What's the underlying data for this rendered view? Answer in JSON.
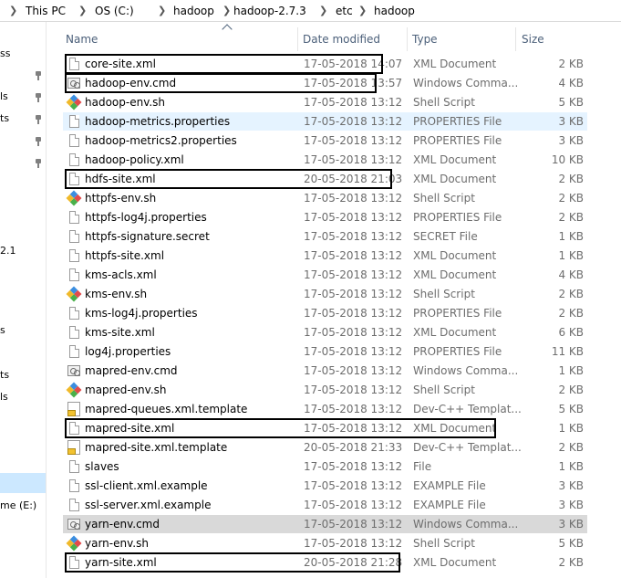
{
  "breadcrumb": [
    "This PC",
    "OS (C:)",
    "hadoop",
    "hadoop-2.7.3",
    "etc",
    "hadoop"
  ],
  "nav_fragments": [
    "ss",
    "ls",
    "ts",
    "2.1",
    "s",
    "ts",
    "ls",
    "me (E:)"
  ],
  "columns": {
    "name": "Name",
    "date": "Date modified",
    "type": "Type",
    "size": "Size"
  },
  "files": [
    {
      "name": "core-site.xml",
      "date": "17-05-2018 14:07",
      "type": "XML Document",
      "size": "2 KB",
      "icon": "file-icon"
    },
    {
      "name": "hadoop-env.cmd",
      "date": "17-05-2018 13:57",
      "type": "Windows Comma...",
      "size": "4 KB",
      "icon": "cmd-icon"
    },
    {
      "name": "hadoop-env.sh",
      "date": "17-05-2018 13:12",
      "type": "Shell Script",
      "size": "5 KB",
      "icon": "shell-icon"
    },
    {
      "name": "hadoop-metrics.properties",
      "date": "17-05-2018 13:12",
      "type": "PROPERTIES File",
      "size": "3 KB",
      "icon": "file-icon"
    },
    {
      "name": "hadoop-metrics2.properties",
      "date": "17-05-2018 13:12",
      "type": "PROPERTIES File",
      "size": "3 KB",
      "icon": "file-icon"
    },
    {
      "name": "hadoop-policy.xml",
      "date": "17-05-2018 13:12",
      "type": "XML Document",
      "size": "10 KB",
      "icon": "file-icon"
    },
    {
      "name": "hdfs-site.xml",
      "date": "20-05-2018 21:03",
      "type": "XML Document",
      "size": "2 KB",
      "icon": "file-icon"
    },
    {
      "name": "httpfs-env.sh",
      "date": "17-05-2018 13:12",
      "type": "Shell Script",
      "size": "2 KB",
      "icon": "shell-icon"
    },
    {
      "name": "httpfs-log4j.properties",
      "date": "17-05-2018 13:12",
      "type": "PROPERTIES File",
      "size": "2 KB",
      "icon": "file-icon"
    },
    {
      "name": "httpfs-signature.secret",
      "date": "17-05-2018 13:12",
      "type": "SECRET File",
      "size": "1 KB",
      "icon": "file-icon"
    },
    {
      "name": "httpfs-site.xml",
      "date": "17-05-2018 13:12",
      "type": "XML Document",
      "size": "1 KB",
      "icon": "file-icon"
    },
    {
      "name": "kms-acls.xml",
      "date": "17-05-2018 13:12",
      "type": "XML Document",
      "size": "4 KB",
      "icon": "file-icon"
    },
    {
      "name": "kms-env.sh",
      "date": "17-05-2018 13:12",
      "type": "Shell Script",
      "size": "2 KB",
      "icon": "shell-icon"
    },
    {
      "name": "kms-log4j.properties",
      "date": "17-05-2018 13:12",
      "type": "PROPERTIES File",
      "size": "2 KB",
      "icon": "file-icon"
    },
    {
      "name": "kms-site.xml",
      "date": "17-05-2018 13:12",
      "type": "XML Document",
      "size": "6 KB",
      "icon": "file-icon"
    },
    {
      "name": "log4j.properties",
      "date": "17-05-2018 13:12",
      "type": "PROPERTIES File",
      "size": "11 KB",
      "icon": "file-icon"
    },
    {
      "name": "mapred-env.cmd",
      "date": "17-05-2018 13:12",
      "type": "Windows Comma...",
      "size": "1 KB",
      "icon": "cmd-icon"
    },
    {
      "name": "mapred-env.sh",
      "date": "17-05-2018 13:12",
      "type": "Shell Script",
      "size": "2 KB",
      "icon": "shell-icon"
    },
    {
      "name": "mapred-queues.xml.template",
      "date": "17-05-2018 13:12",
      "type": "Dev-C++ Templat...",
      "size": "5 KB",
      "icon": "template-icon"
    },
    {
      "name": "mapred-site.xml",
      "date": "17-05-2018 13:12",
      "type": "XML Document",
      "size": "1 KB",
      "icon": "file-icon"
    },
    {
      "name": "mapred-site.xml.template",
      "date": "20-05-2018 21:33",
      "type": "Dev-C++ Templat...",
      "size": "2 KB",
      "icon": "template-icon"
    },
    {
      "name": "slaves",
      "date": "17-05-2018 13:12",
      "type": "File",
      "size": "1 KB",
      "icon": "file-icon"
    },
    {
      "name": "ssl-client.xml.example",
      "date": "17-05-2018 13:12",
      "type": "EXAMPLE File",
      "size": "3 KB",
      "icon": "file-icon"
    },
    {
      "name": "ssl-server.xml.example",
      "date": "17-05-2018 13:12",
      "type": "EXAMPLE File",
      "size": "3 KB",
      "icon": "file-icon"
    },
    {
      "name": "yarn-env.cmd",
      "date": "17-05-2018 13:12",
      "type": "Windows Comma...",
      "size": "3 KB",
      "icon": "cmd-icon"
    },
    {
      "name": "yarn-env.sh",
      "date": "17-05-2018 13:12",
      "type": "Shell Script",
      "size": "5 KB",
      "icon": "shell-icon"
    },
    {
      "name": "yarn-site.xml",
      "date": "20-05-2018 21:28",
      "type": "XML Document",
      "size": "2 KB",
      "icon": "file-icon"
    }
  ],
  "hovered_file": "hadoop-metrics.properties",
  "selected_file": "yarn-env.cmd",
  "highlighted_files": [
    "core-site.xml",
    "hadoop-env.cmd",
    "hdfs-site.xml",
    "mapred-site.xml",
    "yarn-site.xml"
  ]
}
